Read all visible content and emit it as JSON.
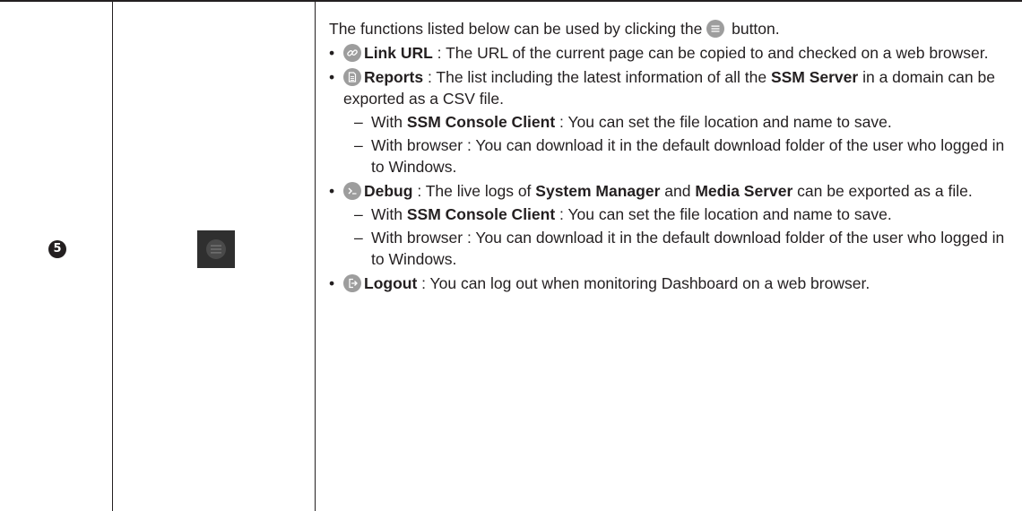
{
  "row": {
    "number": "5"
  },
  "description": {
    "intro_before": "The functions listed below can be used by clicking the",
    "intro_after": "button.",
    "items": [
      {
        "icon": "link-icon",
        "title": "Link URL",
        "text": " : The URL of the current page can be copied to and checked on a web browser."
      },
      {
        "icon": "report-icon",
        "title": "Reports",
        "text_before": " : The list including the latest information of all the ",
        "bold": "SSM Server",
        "text_after": " in a domain can be exported as a CSV file.",
        "subs": [
          {
            "bold": "With ",
            "bold_part": "SSM Console Client",
            "text": " : You can set the file location and name to save."
          },
          {
            "text": "With browser : You can download it in the default download folder of the user who logged in to Windows."
          }
        ]
      },
      {
        "icon": "terminal-icon",
        "title": "Debug",
        "text_before": " : The live logs of ",
        "bold1": "System Manager",
        "mid": " and ",
        "bold2": "Media Server",
        "text_after": " can be exported as a file.",
        "subs": [
          {
            "bold_part": "SSM Console Client",
            "text": " : You can set the file location and name to save."
          },
          {
            "text": "With browser : You can download it in the default download folder of the user who logged in to Windows."
          }
        ]
      },
      {
        "icon": "logout-icon",
        "title": "Logout",
        "text": " : You can log out when monitoring Dashboard on a web browser."
      }
    ],
    "bullet": "•",
    "dash": "–",
    "with_prefix": "With "
  },
  "colors": {
    "text": "#231f20",
    "icon_gray": "#9d9d9d",
    "tile_dark": "#2f2f2f"
  }
}
